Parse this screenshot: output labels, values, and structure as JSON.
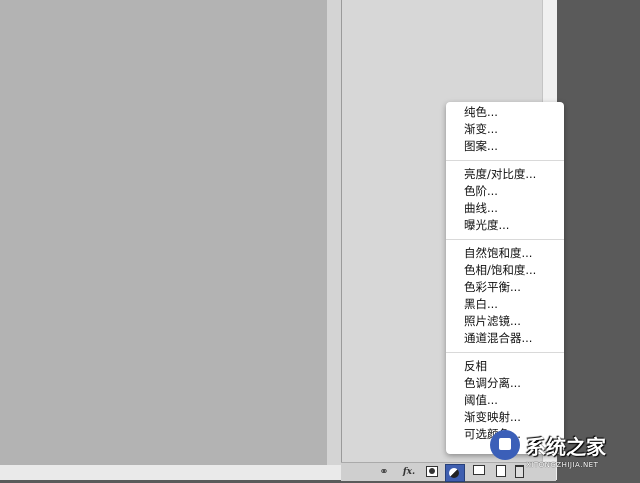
{
  "menu": {
    "sections": [
      [
        "纯色...",
        "渐变...",
        "图案..."
      ],
      [
        "亮度/对比度...",
        "色阶...",
        "曲线...",
        "曝光度..."
      ],
      [
        "自然饱和度...",
        "色相/饱和度...",
        "色彩平衡...",
        "黑白...",
        "照片滤镜...",
        "通道混合器..."
      ],
      [
        "反相",
        "色调分离...",
        "阈值...",
        "渐变映射...",
        "可选颜色..."
      ]
    ]
  },
  "toolbar": {
    "link_icon": "link-icon",
    "fx_label": "fx.",
    "mask_icon": "layer-mask-icon",
    "adjust_icon": "adjustment-layer-icon",
    "group_icon": "folder-icon",
    "new_icon": "new-layer-icon",
    "trash_icon": "trash-icon"
  },
  "watermark": {
    "title": "系统之家",
    "url": "XITONGZHIJIA.NET"
  },
  "colors": {
    "canvas": "#b3b3b3",
    "panel": "#d7d7d7",
    "background": "#5a5a5a",
    "adjust_active": "#3f5fb0"
  }
}
